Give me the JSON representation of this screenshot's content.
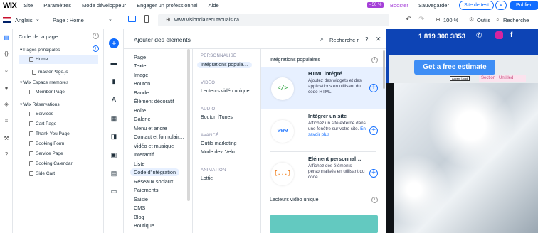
{
  "topbar": {
    "logo": "WIX",
    "menu": [
      "Site",
      "Paramètres",
      "Mode développeur",
      "Engager un professionnel",
      "Aide"
    ],
    "promo_badge": "- 50 %",
    "booster": "Booster",
    "save": "Sauvegarder",
    "test_site": "Site de test",
    "test_more": "∨",
    "publish": "Publier"
  },
  "subbar": {
    "language": "Anglais",
    "page_label": "Page :  Home",
    "url": "www.visionclaireoutaouais.ca",
    "zoom": "100 %",
    "tools": "Outils",
    "search": "Recherche"
  },
  "pages_panel": {
    "title": "Code de la page",
    "groups": {
      "main": "▾ Pages principales",
      "members": "▾ Wix Espace membres",
      "reservations": "▾ Wix Réservations"
    },
    "main_pages": [
      "Home"
    ],
    "js_file": "masterPage.js",
    "member_pages": [
      "Member Page"
    ],
    "reservation_pages": [
      "Services",
      "Cart Page",
      "Thank You Page",
      "Booking Form",
      "Service Page",
      "Booking Calendar",
      "Side Cart"
    ]
  },
  "add_panel": {
    "title": "Ajouter des éléments",
    "search": "Recherche r",
    "categories": [
      "Page",
      "Texte",
      "Image",
      "Bouton",
      "Bande",
      "Élément décoratif",
      "Boîte",
      "Galerie",
      "Menu et ancre",
      "Contact et formulair…",
      "Vidéo et musique",
      "Interactif",
      "Liste",
      "Code d'intégration",
      "Réseaux sociaux",
      "Paiements",
      "Saisie",
      "CMS",
      "Blog",
      "Boutique"
    ],
    "selected_category": "Code d'intégration",
    "subcategories": [
      {
        "head": "PERSONNALISÉ",
        "items": [
          "Intégrations popula…"
        ]
      },
      {
        "head": "VIDÉO",
        "items": [
          "Lecteurs vidéo unique"
        ]
      },
      {
        "head": "AUDIO",
        "items": [
          "Bouton iTunes"
        ]
      },
      {
        "head": "AVANCÉ",
        "items": [
          "Outils marketing",
          "Mode dev. Velo"
        ]
      },
      {
        "head": "ANIMATION",
        "items": [
          "Lottie"
        ]
      }
    ],
    "popular_title": "Intégrations populaires",
    "cards": [
      {
        "icon": "</>",
        "icon_color": "#3aa84a",
        "title": "HTML intégré",
        "desc": "Ajoutez des widgets et des applications en utilisant du code HTML.",
        "link": ""
      },
      {
        "icon": "www",
        "icon_color": "#116dff",
        "title": "Intégrer un site",
        "desc": "Affichez un site externe dans une fenêtre sur votre site.",
        "link": "En savoir plus"
      },
      {
        "icon": "{...}",
        "icon_color": "#f07b16",
        "title": "Élément personnal…",
        "desc": "Affichez des éléments personnalisés en utilisant du code.",
        "link": ""
      }
    ],
    "video_title": "Lecteurs vidéo unique"
  },
  "canvas": {
    "phone": "1 819 300 3853",
    "cta": "Get a free estimate",
    "anchor_tag": "Accent Load",
    "section_tag": "Section : Untitled"
  },
  "colors": {
    "accent": "#116dff",
    "booster": "#a53fd8",
    "site_header": "#0d44b5"
  }
}
